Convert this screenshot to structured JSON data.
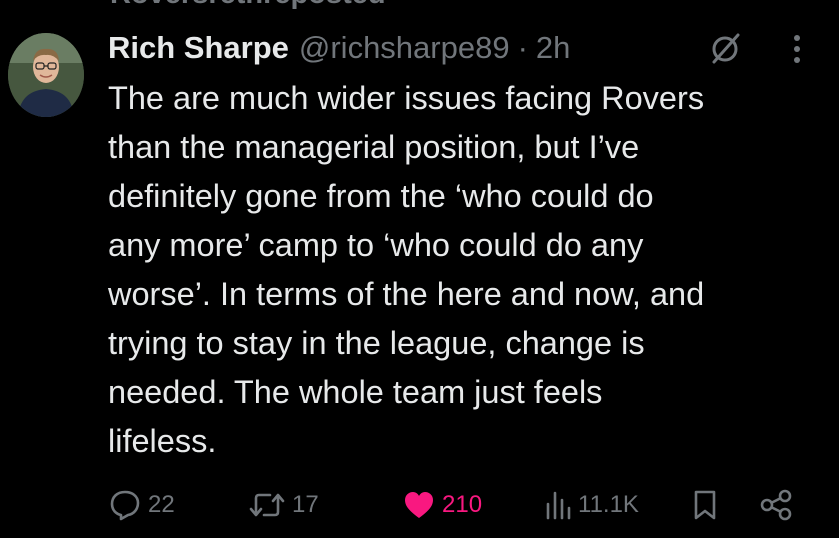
{
  "repost_banner": "Roversrethreposted",
  "tweet": {
    "author_name": "Rich Sharpe",
    "handle": "@richsharpe89",
    "separator": "·",
    "time": "2h",
    "body": "The are much wider issues facing Rovers\nthan the managerial position, but I’ve\ndefinitely gone from the ‘who could do\nany more’ camp to ‘who could do any\nworse’. In terms of the here and now, and\ntrying to stay in the league, change is\nneeded. The whole team just feels\nlifeless."
  },
  "actions": {
    "replies": "22",
    "reposts": "17",
    "likes": "210",
    "views": "11.1K"
  },
  "colors": {
    "background": "#000000",
    "text": "#e7e9ea",
    "muted": "#71767b",
    "like": "#f91880"
  },
  "icons": [
    "grok-icon",
    "more-icon",
    "reply-icon",
    "retweet-icon",
    "heart-icon",
    "views-icon",
    "bookmark-icon",
    "share-icon"
  ]
}
